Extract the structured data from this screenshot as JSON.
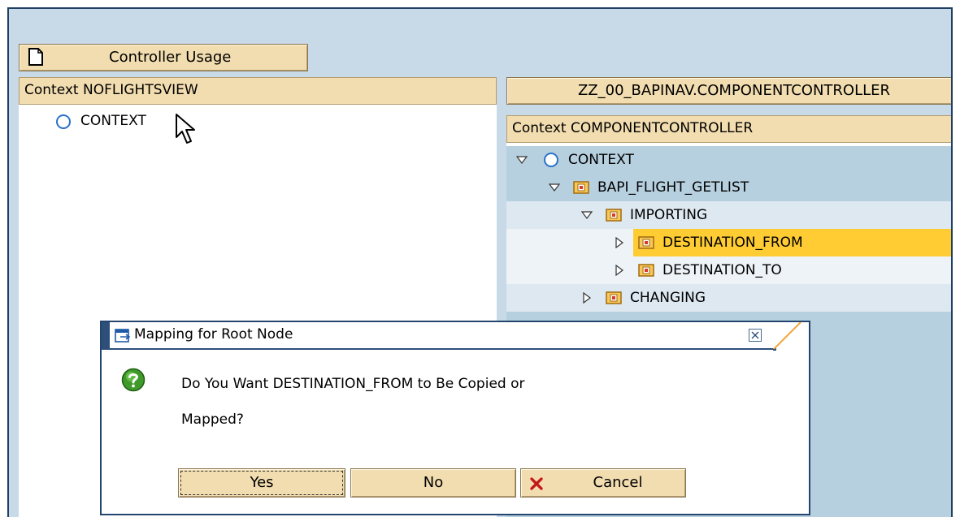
{
  "toolbar": {
    "controller_usage_label": "Controller Usage"
  },
  "left_panel": {
    "header": "Context NOFLIGHTSVIEW",
    "root_label": "CONTEXT"
  },
  "right_panel": {
    "controller_button": "ZZ_00_BAPINAV.COMPONENTCONTROLLER",
    "header": "Context COMPONENTCONTROLLER",
    "tree": [
      {
        "label": "CONTEXT"
      },
      {
        "label": "BAPI_FLIGHT_GETLIST"
      },
      {
        "label": "IMPORTING"
      },
      {
        "label": "DESTINATION_FROM",
        "selected": true
      },
      {
        "label": "DESTINATION_TO"
      },
      {
        "label": "CHANGING"
      }
    ]
  },
  "dialog": {
    "title": "Mapping for Root Node",
    "message_line1": "Do You Want DESTINATION_FROM to Be Copied or",
    "message_line2": "Mapped?",
    "buttons": {
      "yes": "Yes",
      "no": "No",
      "cancel": "Cancel"
    }
  },
  "colors": {
    "frame_bg": "#c8d9e8",
    "header_bg": "#f2ddb0",
    "selected_row": "#ffcc33",
    "tree_strip_blue": "#b7d0df",
    "tree_strip_light": "#dde8f0",
    "dialog_border": "#24466e"
  },
  "icons": {
    "toolbar": "document-icon",
    "root": "context-circle-icon",
    "node": "folder-node-icon",
    "expand": "expand-triangle-icon",
    "question": "question-icon",
    "cancel": "red-x-icon",
    "close": "close-icon",
    "dialog": "popup-window-icon"
  }
}
